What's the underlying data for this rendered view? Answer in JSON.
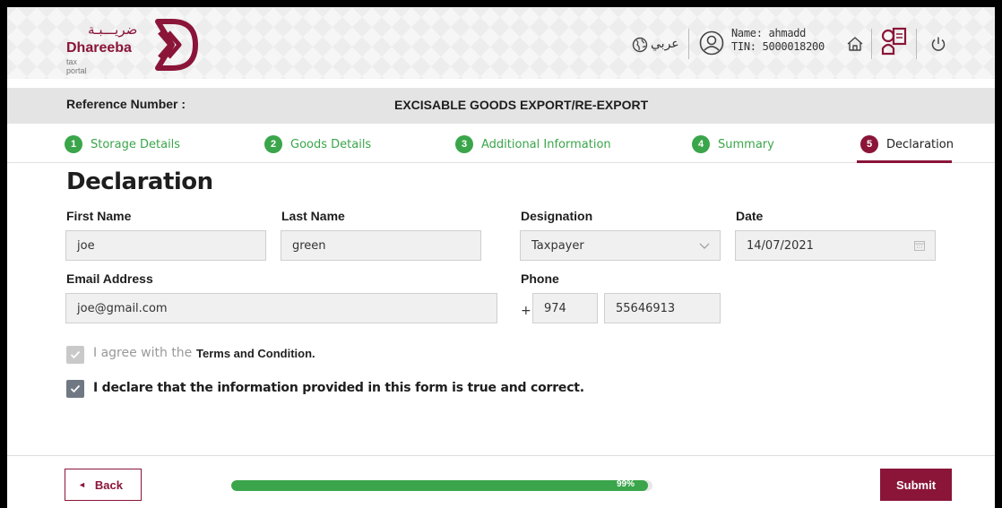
{
  "header": {
    "logo_arabic": "ضريـــبـة",
    "logo_name": "Dhareeba",
    "logo_sub": "tax portal",
    "language_label": "عربي",
    "user_name": "Name: ahmadd",
    "user_tin": "TIN: 5000018200",
    "icons": [
      "globe-icon",
      "user-icon",
      "home-icon",
      "help-book-icon",
      "power-icon"
    ]
  },
  "titlebar": {
    "reference_label": "Reference Number :",
    "form_title": "EXCISABLE GOODS EXPORT/RE-EXPORT"
  },
  "steps": [
    {
      "num": "1",
      "label": "Storage Details",
      "state": "complete"
    },
    {
      "num": "2",
      "label": "Goods Details",
      "state": "complete"
    },
    {
      "num": "3",
      "label": "Additional Information",
      "state": "complete"
    },
    {
      "num": "4",
      "label": "Summary",
      "state": "complete"
    },
    {
      "num": "5",
      "label": "Declaration",
      "state": "active"
    }
  ],
  "declaration": {
    "title": "Declaration",
    "first_name_label": "First Name",
    "first_name_value": "joe",
    "last_name_label": "Last Name",
    "last_name_value": "green",
    "designation_label": "Designation",
    "designation_value": "Taxpayer",
    "date_label": "Date",
    "date_value": "14/07/2021",
    "email_label": "Email Address",
    "email_value": "joe@gmail.com",
    "phone_label": "Phone",
    "phone_plus": "+",
    "phone_code": "974",
    "phone_number": "55646913",
    "agree_text": "I agree with the",
    "agree_link": "Terms and Condition.",
    "agree_checked": true,
    "declare_text": "I declare that the information provided in this form is true and correct.",
    "declare_checked": true
  },
  "footer": {
    "back_label": "Back",
    "progress_percent": 99,
    "progress_text": "99%",
    "submit_label": "Submit"
  },
  "colors": {
    "brand": "#8a1538",
    "success": "#3aa54a",
    "checkbox_on": "#6f7883"
  }
}
